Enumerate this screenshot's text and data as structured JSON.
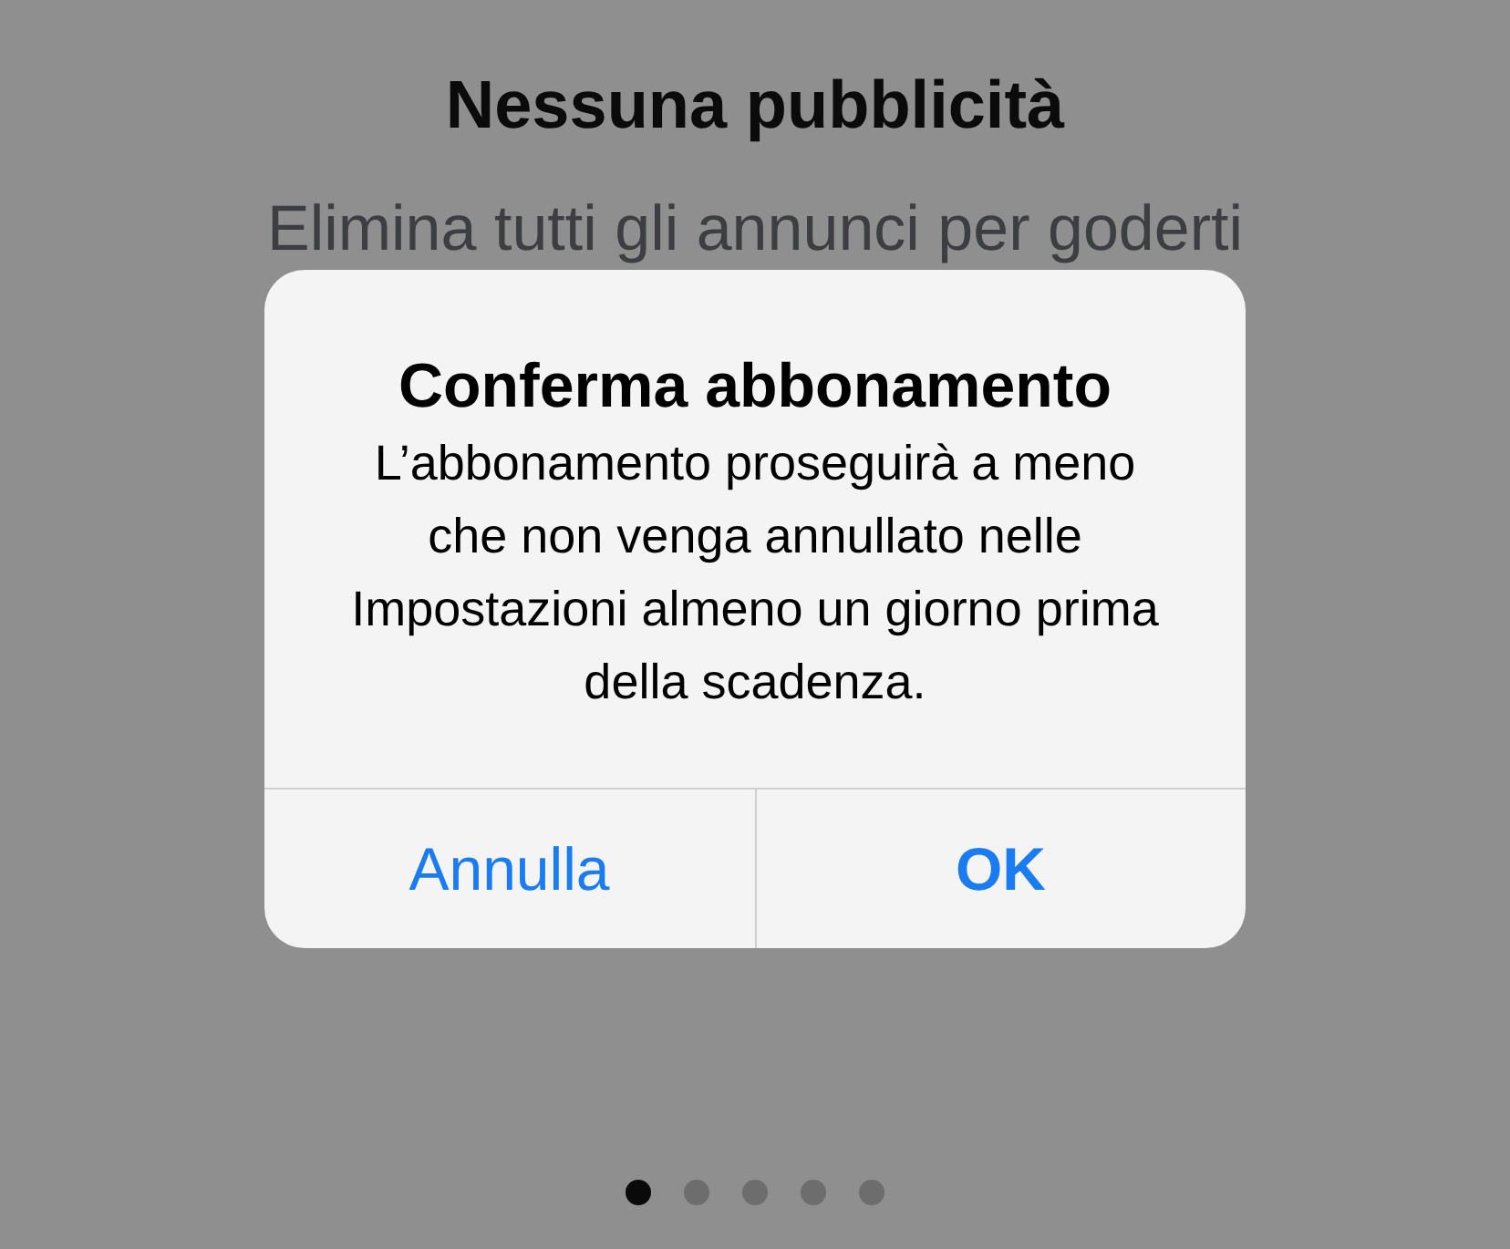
{
  "screen": {
    "title": "Nessuna pubblicità",
    "subtitle": "Elimina tutti gli annunci per goderti"
  },
  "alert": {
    "title": "Conferma abbonamento",
    "message": "L’abbonamento proseguirà a meno che non venga annullato nelle Impostazioni almeno un giorno prima della scadenza.",
    "buttons": [
      {
        "label": "Annulla",
        "kind": "cancel"
      },
      {
        "label": "OK",
        "kind": "default"
      }
    ]
  },
  "page_dots": [
    {
      "selected": true
    },
    {
      "selected": false
    },
    {
      "selected": false
    },
    {
      "selected": false
    },
    {
      "selected": false
    }
  ]
}
